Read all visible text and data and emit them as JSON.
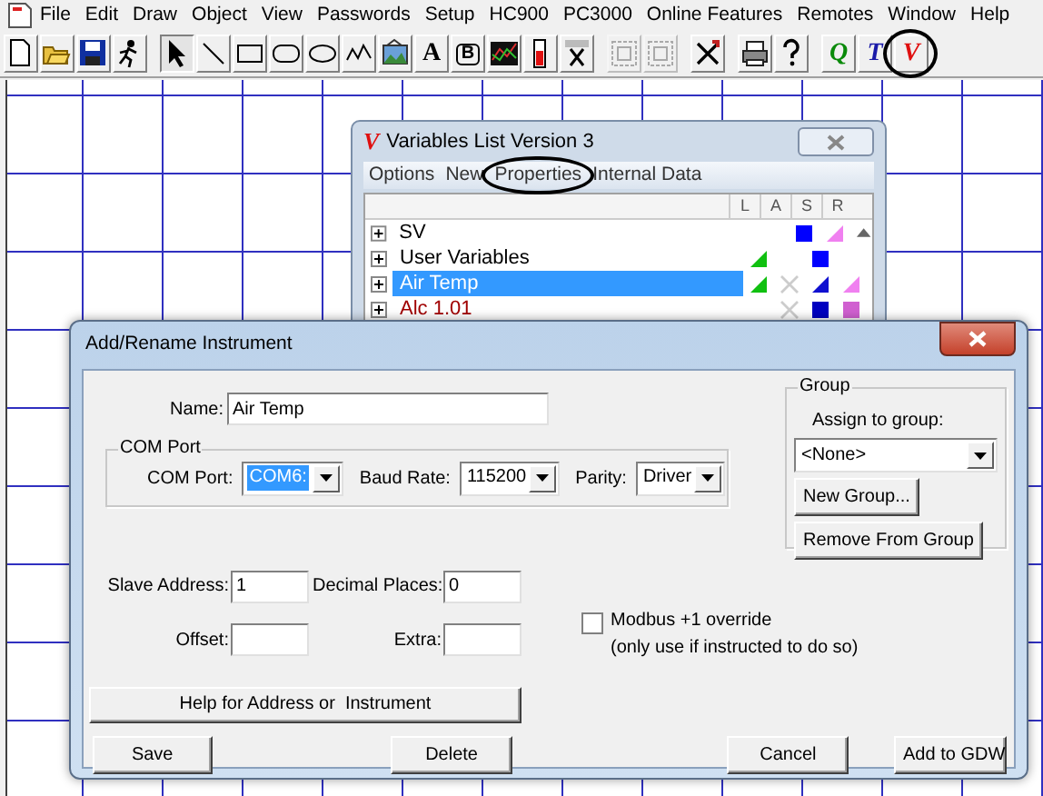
{
  "menu": [
    {
      "label": "File"
    },
    {
      "label": "Edit"
    },
    {
      "label": "Draw"
    },
    {
      "label": "Object"
    },
    {
      "label": "View"
    },
    {
      "label": "Passwords"
    },
    {
      "label": "Setup"
    },
    {
      "label": "HC900"
    },
    {
      "label": "PC3000"
    },
    {
      "label": "Online Features"
    },
    {
      "label": "Remotes"
    },
    {
      "label": "Window"
    },
    {
      "label": "Help"
    }
  ],
  "toolbar": [
    {
      "kind": "new",
      "pressed": false,
      "disabled": false,
      "circled": false
    },
    {
      "kind": "open",
      "pressed": false,
      "disabled": false,
      "circled": false
    },
    {
      "kind": "save",
      "pressed": false,
      "disabled": false,
      "circled": false
    },
    {
      "kind": "run",
      "pressed": false,
      "disabled": false,
      "circled": false,
      "gap_after": true
    },
    {
      "kind": "pointer",
      "pressed": true,
      "disabled": false,
      "circled": false
    },
    {
      "kind": "line",
      "pressed": false,
      "disabled": false,
      "circled": false
    },
    {
      "kind": "rect",
      "pressed": false,
      "disabled": false,
      "circled": false
    },
    {
      "kind": "rounded-rect",
      "pressed": false,
      "disabled": false,
      "circled": false
    },
    {
      "kind": "ellipse",
      "pressed": false,
      "disabled": false,
      "circled": false
    },
    {
      "kind": "polyline",
      "pressed": false,
      "disabled": false,
      "circled": false
    },
    {
      "kind": "picture",
      "pressed": false,
      "disabled": false,
      "circled": false
    },
    {
      "kind": "letter",
      "glyph": "A",
      "pressed": false,
      "disabled": false,
      "circled": false
    },
    {
      "kind": "boxed-letter",
      "glyph": "B",
      "pressed": false,
      "disabled": false,
      "circled": false
    },
    {
      "kind": "chart",
      "pressed": false,
      "disabled": false,
      "circled": false
    },
    {
      "kind": "bar",
      "pressed": false,
      "disabled": false,
      "circled": false
    },
    {
      "kind": "activex",
      "pressed": false,
      "disabled": false,
      "circled": false,
      "gap_after": true
    },
    {
      "kind": "group",
      "pressed": false,
      "disabled": true,
      "circled": false
    },
    {
      "kind": "group",
      "pressed": false,
      "disabled": true,
      "circled": false,
      "gap_after": true
    },
    {
      "kind": "tools",
      "pressed": false,
      "disabled": false,
      "circled": false,
      "gap_after": true
    },
    {
      "kind": "print",
      "pressed": false,
      "disabled": false,
      "circled": false
    },
    {
      "kind": "help",
      "pressed": false,
      "disabled": false,
      "circled": false,
      "gap_after": true
    },
    {
      "kind": "letter",
      "glyph": "Q",
      "color": "#0a8a0a",
      "pressed": false,
      "disabled": false,
      "circled": false
    },
    {
      "kind": "letter",
      "glyph": "T",
      "color": "#1a1aa8",
      "pressed": false,
      "disabled": false,
      "circled": false
    },
    {
      "kind": "letter",
      "glyph": "V",
      "color": "#e01010",
      "pressed": false,
      "disabled": false,
      "circled": true
    }
  ],
  "variables_window": {
    "logo": "V",
    "title": "Variables List Version 3",
    "menu": [
      {
        "label": "Options",
        "circled": false
      },
      {
        "label": "New",
        "circled": false
      },
      {
        "label": "Properties",
        "circled": true
      },
      {
        "label": "Internal Data",
        "circled": false
      }
    ],
    "columns": [
      "L",
      "A",
      "S",
      "R"
    ],
    "rows": [
      {
        "name": "SV",
        "selected": false,
        "alarm": false,
        "cells": [
          {
            "kind": "none"
          },
          {
            "kind": "none"
          },
          {
            "kind": "square",
            "color": "#0000ff"
          },
          {
            "kind": "triangle",
            "color": "#f080f0"
          }
        ]
      },
      {
        "name": "User Variables",
        "selected": false,
        "alarm": false,
        "cells": [
          {
            "kind": "triangle",
            "color": "#10c010"
          },
          {
            "kind": "none"
          },
          {
            "kind": "square",
            "color": "#0000ff"
          },
          {
            "kind": "none"
          }
        ]
      },
      {
        "name": "Air Temp",
        "selected": true,
        "alarm": false,
        "cells": [
          {
            "kind": "triangle",
            "color": "#10c010"
          },
          {
            "kind": "cross"
          },
          {
            "kind": "triangle",
            "color": "#1010d0"
          },
          {
            "kind": "triangle",
            "color": "#f080f0"
          }
        ]
      },
      {
        "name": "Alc 1.01",
        "selected": false,
        "alarm": true,
        "cells": [
          {
            "kind": "none"
          },
          {
            "kind": "cross"
          },
          {
            "kind": "square",
            "color": "#0000c0"
          },
          {
            "kind": "square",
            "color": "#d060d0"
          }
        ]
      }
    ]
  },
  "dialog": {
    "title": "Add/Rename Instrument",
    "name": {
      "label": "Name:",
      "value": "Air Temp"
    },
    "com_group": {
      "legend": "COM Port",
      "fields": [
        {
          "label": "COM Port:",
          "value": "COM6:",
          "highlighted": true
        },
        {
          "label": "Baud Rate:",
          "value": "115200",
          "highlighted": false
        },
        {
          "label": "Parity:",
          "value": "Driver",
          "highlighted": false
        }
      ]
    },
    "group": {
      "legend": "Group",
      "assign_label": "Assign to group:",
      "assign_value": "<None>",
      "buttons": [
        "New Group...",
        "Remove From Group"
      ]
    },
    "address_fields": [
      {
        "label": "Slave Address:",
        "value": "1"
      },
      {
        "label": "Decimal Places:",
        "value": "0"
      },
      {
        "label": "Offset:"
      },
      {
        "label": "Extra:"
      }
    ],
    "modbus_override": {
      "checked": false,
      "label": "Modbus +1 override",
      "note": "(only use if instructed to do so)"
    },
    "help_button": "Help for Address or  Instrument",
    "buttons": [
      "Save",
      "Delete",
      "Cancel",
      "Add to GDW"
    ]
  }
}
